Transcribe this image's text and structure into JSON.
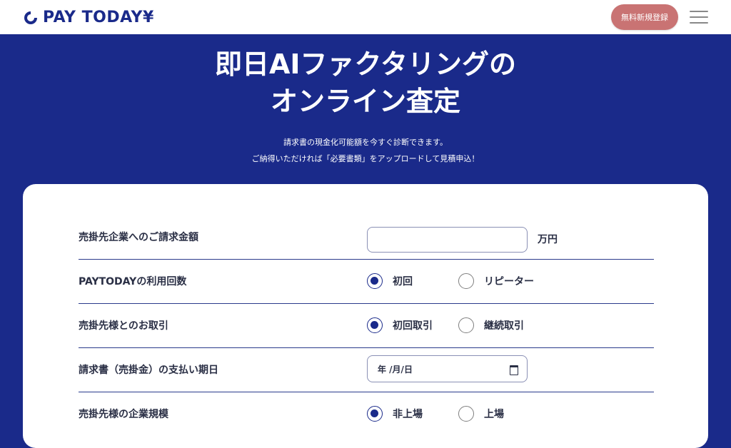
{
  "header": {
    "logo_text": "PAY TODAY¥",
    "signup_label": "無料新規登録"
  },
  "hero": {
    "title_line1": "即日AIファクタリングの",
    "title_line2": "オンライン査定",
    "sub_line1": "請求書の現金化可能額を今すぐ診断できます。",
    "sub_line2": "ご納得いただければ「必要書類」をアップロードして見積申込！"
  },
  "form": {
    "amount": {
      "label": "売掛先企業へのご請求金額",
      "value": "",
      "unit": "万円"
    },
    "usage": {
      "label": "PAYTODAYの利用回数",
      "options": [
        "初回",
        "リピーター"
      ],
      "selected": 0
    },
    "relation": {
      "label": "売掛先様とのお取引",
      "options": [
        "初回取引",
        "継続取引"
      ],
      "selected": 0
    },
    "due_date": {
      "label": "請求書（売掛金）の支払い期日",
      "placeholder": "年 /月/日"
    },
    "scale": {
      "label": "売掛先様の企業規模",
      "options": [
        "非上場",
        "上場"
      ],
      "selected": 0
    }
  },
  "colors": {
    "brand": "#1a2a8a",
    "accent": "#c97373"
  },
  "icons": [
    "menu-icon",
    "calendar-icon",
    "logo-icon"
  ]
}
